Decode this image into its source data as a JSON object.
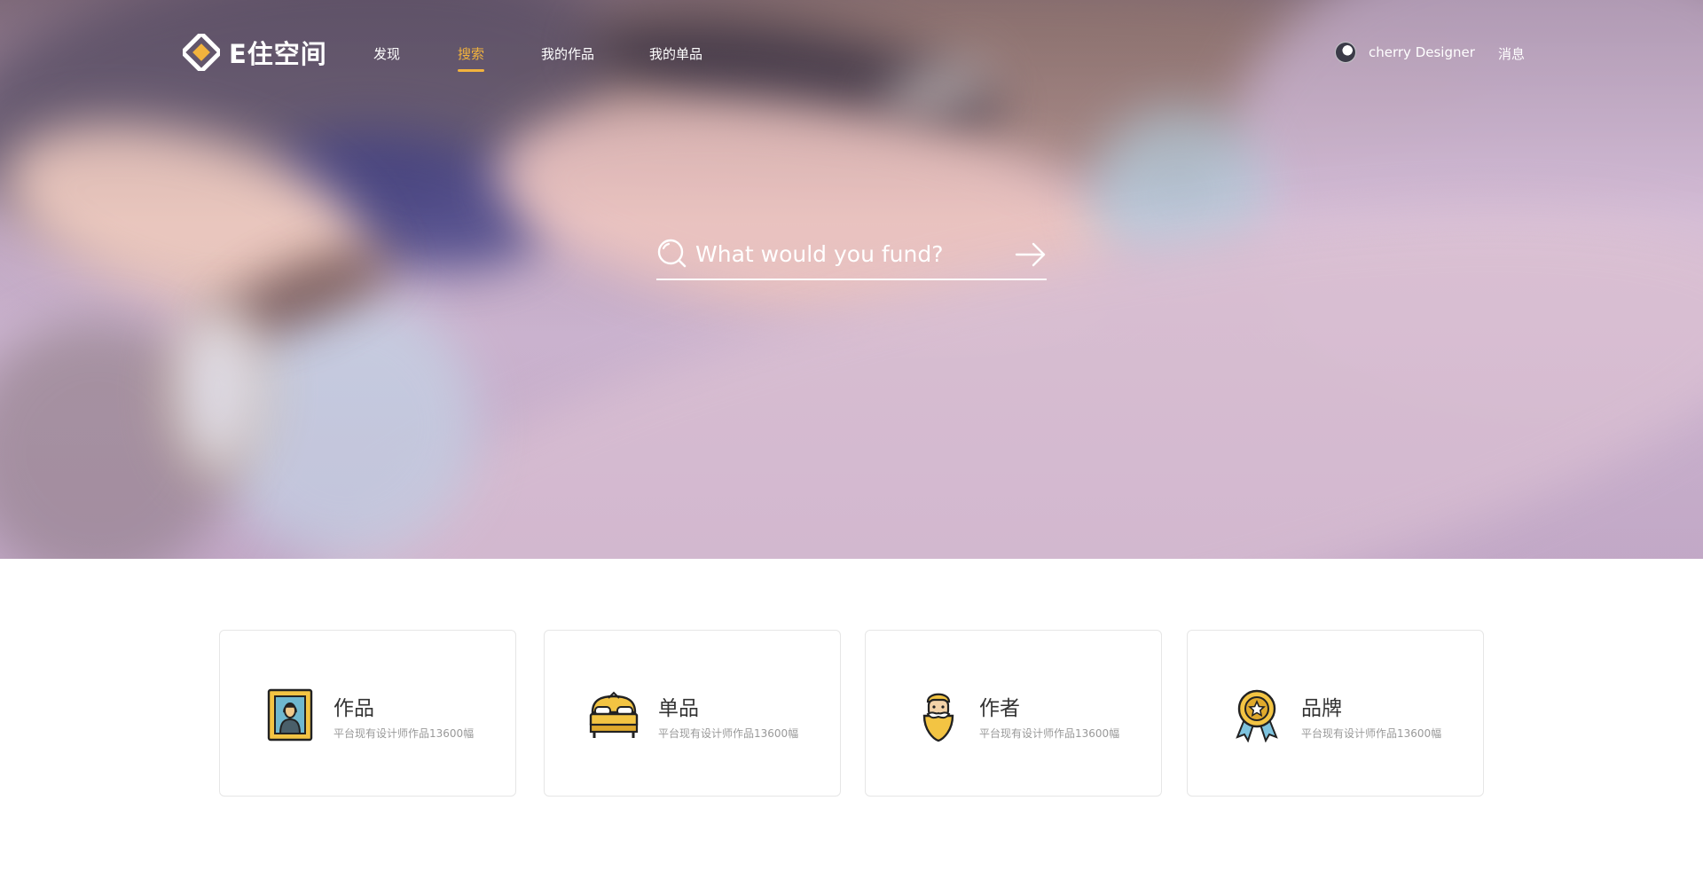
{
  "brand": {
    "name": "E住空间",
    "accent": "#f2b33d"
  },
  "nav": {
    "items": [
      {
        "label": "发现",
        "active": false
      },
      {
        "label": "搜索",
        "active": true
      },
      {
        "label": "我的作品",
        "active": false
      },
      {
        "label": "我的单品",
        "active": false
      }
    ],
    "user_name": "cherry Designer",
    "messages_label": "消息"
  },
  "search": {
    "placeholder": "What would you fund?",
    "icon": "search-icon",
    "submit_icon": "arrow-right-icon"
  },
  "cards": [
    {
      "title": "作品",
      "subtitle": "平台现有设计师作品13600幅",
      "icon": "framed-portrait-icon"
    },
    {
      "title": "单品",
      "subtitle": "平台现有设计师作品13600幅",
      "icon": "bed-icon"
    },
    {
      "title": "作者",
      "subtitle": "平台现有设计师作品13600幅",
      "icon": "bearded-artist-icon"
    },
    {
      "title": "品牌",
      "subtitle": "平台现有设计师作品13600幅",
      "icon": "award-medal-icon"
    }
  ]
}
